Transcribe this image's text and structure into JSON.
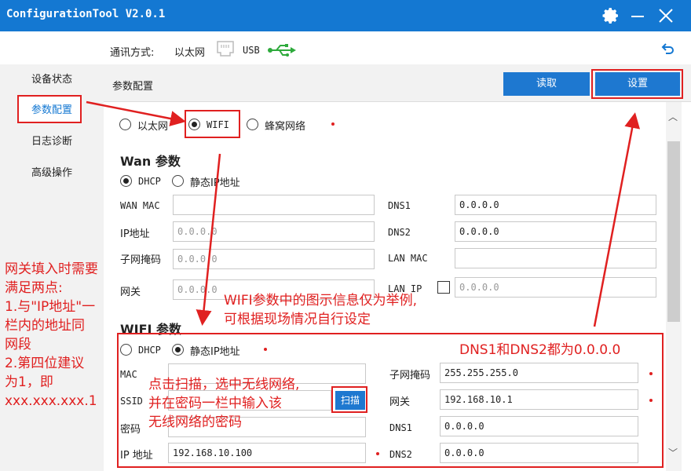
{
  "titlebar": {
    "title": "ConfigurationTool V2.0.1",
    "icons": [
      "gear-icon",
      "minimize-icon",
      "close-icon"
    ]
  },
  "comm": {
    "label": "通讯方式:",
    "ethernet": "以太网",
    "usb": "USB"
  },
  "sidebar": {
    "items": [
      {
        "label": "设备状态"
      },
      {
        "label": "参数配置"
      },
      {
        "label": "日志诊断"
      },
      {
        "label": "高级操作"
      }
    ]
  },
  "main": {
    "title": "参数配置",
    "read_label": "读取",
    "set_label": "设置"
  },
  "mode": {
    "ethernet": "以太网",
    "wifi": "WIFI",
    "cellular": "蜂窝网络",
    "selected": "WIFI"
  },
  "wan": {
    "title": "Wan 参数",
    "dhcp": "DHCP",
    "static": "静态IP地址",
    "selected": "DHCP",
    "fields": {
      "wan_mac": {
        "label": "WAN MAC",
        "value": ""
      },
      "ip": {
        "label": "IP地址",
        "placeholder": "0.0.0.0"
      },
      "mask": {
        "label": "子网掩码",
        "placeholder": "0.0.0.0"
      },
      "gateway": {
        "label": "网关",
        "placeholder": "0.0.0.0"
      },
      "dns1": {
        "label": "DNS1",
        "value": "0.0.0.0"
      },
      "dns2": {
        "label": "DNS2",
        "value": "0.0.0.0"
      },
      "lan_mac": {
        "label": "LAN MAC",
        "value": ""
      },
      "lan_ip": {
        "label": "LAN IP",
        "placeholder": "0.0.0.0"
      }
    }
  },
  "wifi": {
    "title": "WIFI 参数",
    "dhcp": "DHCP",
    "static": "静态IP地址",
    "selected": "静态IP地址",
    "scan_label": "扫描",
    "fields": {
      "mac": {
        "label": "MAC",
        "value": ""
      },
      "ssid": {
        "label": "SSID",
        "value": ""
      },
      "password": {
        "label": "密码",
        "value": ""
      },
      "ip": {
        "label": "IP 地址",
        "value": "192.168.10.100"
      },
      "mask": {
        "label": "子网掩码",
        "value": "255.255.255.0"
      },
      "gateway": {
        "label": "网关",
        "value": "192.168.10.1"
      },
      "dns1": {
        "label": "DNS1",
        "value": "0.0.0.0"
      },
      "dns2": {
        "label": "DNS2",
        "value": "0.0.0.0"
      }
    }
  },
  "annotations": {
    "gateway_note": [
      "网关填入时需要",
      "满足两点:",
      "1.与\"IP地址\"一",
      "栏内的地址同",
      "网段",
      "2.第四位建议",
      "为1，即",
      "xxx.xxx.xxx.1"
    ],
    "wifi_note": [
      "WIFI参数中的图示信息仅为举例,",
      "可根据现场情况自行设定"
    ],
    "dns_note": "DNS1和DNS2都为0.0.0.0",
    "scan_note": [
      "点击扫描，选中无线网络,",
      "并在密码一栏中输入该",
      "无线网络的密码"
    ]
  },
  "colors": {
    "titlebar": "#1478d2",
    "button": "#1e78d0",
    "annotation": "#e02020",
    "usb": "#2eaa3c"
  }
}
